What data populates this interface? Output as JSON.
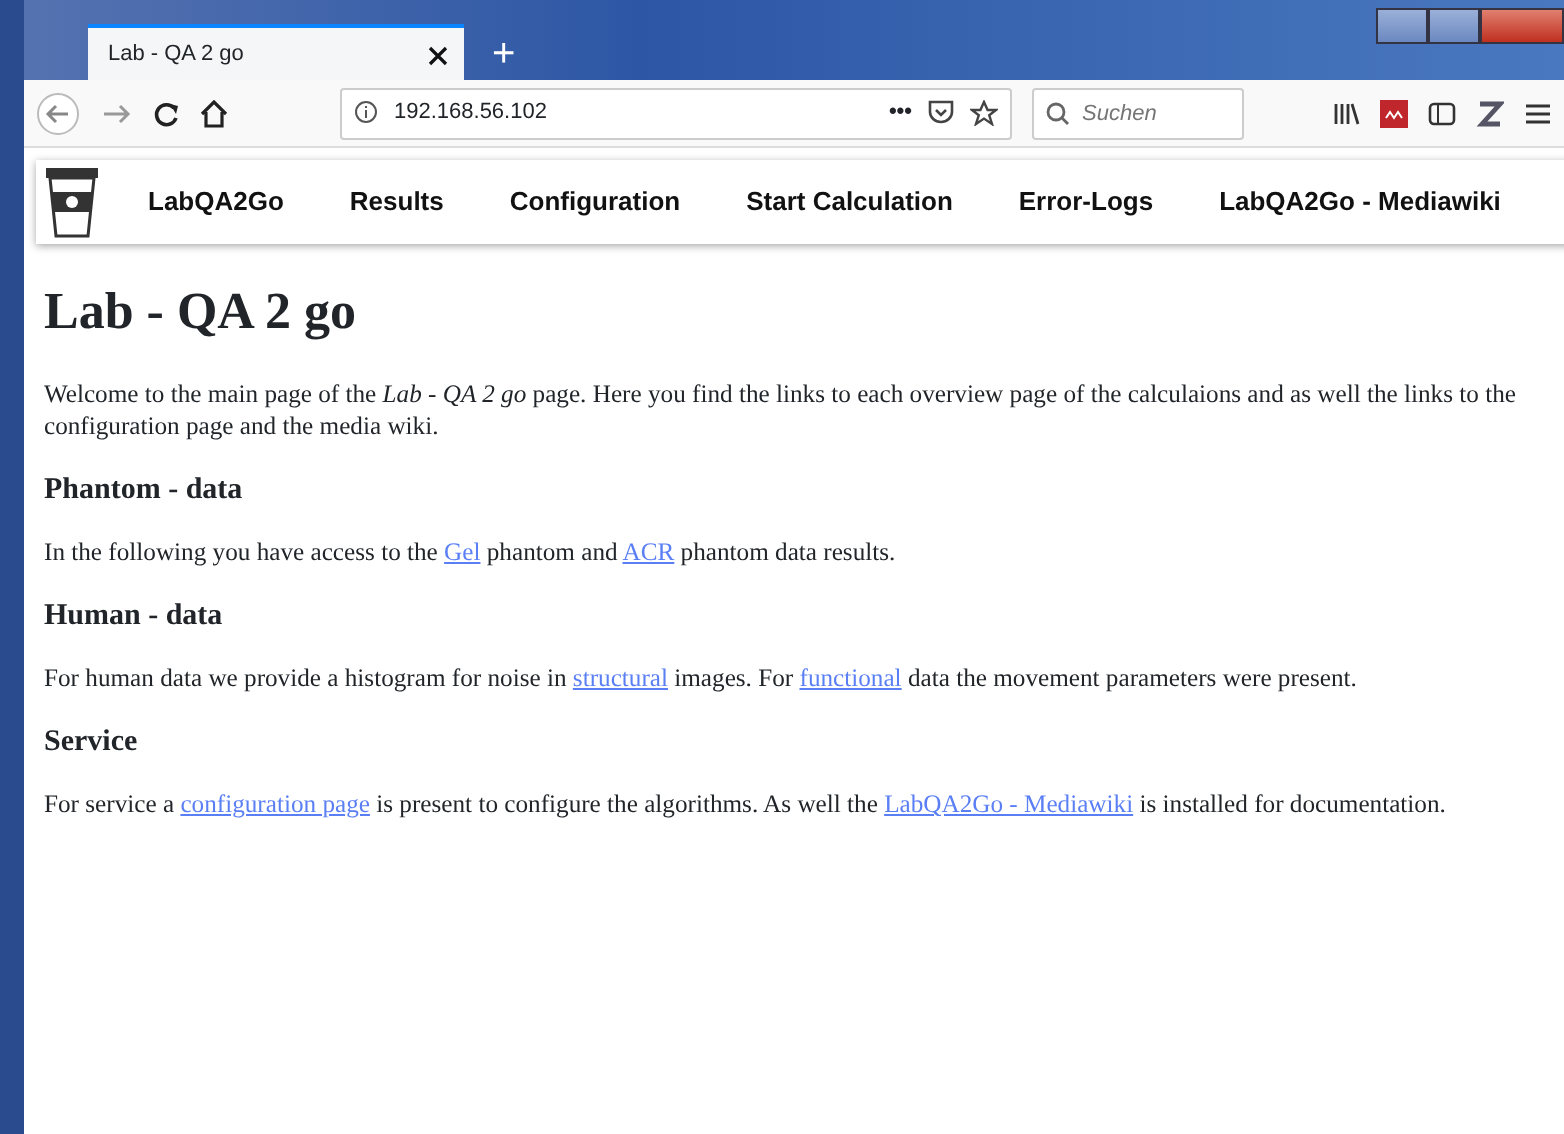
{
  "browser": {
    "tab_title": "Lab - QA 2 go",
    "new_tab": "+",
    "address": "192.168.56.102",
    "page_actions": "•••",
    "search_placeholder": "Suchen"
  },
  "navbar": {
    "items": [
      "LabQA2Go",
      "Results",
      "Configuration",
      "Start Calculation",
      "Error-Logs",
      "LabQA2Go - Mediawiki"
    ]
  },
  "title": "Lab - QA 2 go",
  "sections": [
    {
      "paragraph": [
        {
          "text": "Welcome to the main page of the *Lab - QA 2 go* page. Here you find the links to each overview page of the calculaions and as well the links to the configuration page and the media wiki."
        }
      ]
    },
    {
      "heading": "Phantom - data",
      "paragraph": [
        {
          "text": "In the following you have access to the "
        },
        {
          "link": "Gel"
        },
        {
          "text": " phantom and "
        },
        {
          "link": "ACR"
        },
        {
          "text": " phantom data results."
        }
      ]
    },
    {
      "heading": "Human - data",
      "paragraph": [
        {
          "text": "For human data we provide a histogram for noise in "
        },
        {
          "link": "structural"
        },
        {
          "text": " images. For "
        },
        {
          "link": "functional"
        },
        {
          "text": " data the movement parameters were present."
        }
      ]
    },
    {
      "heading": "Service",
      "paragraph": [
        {
          "text": "For service a "
        },
        {
          "link": "configuration page"
        },
        {
          "text": " is present to configure the algorithms. As well the "
        },
        {
          "link": "LabQA2Go - Mediawiki"
        },
        {
          "text": " is installed for documentation."
        }
      ]
    }
  ]
}
